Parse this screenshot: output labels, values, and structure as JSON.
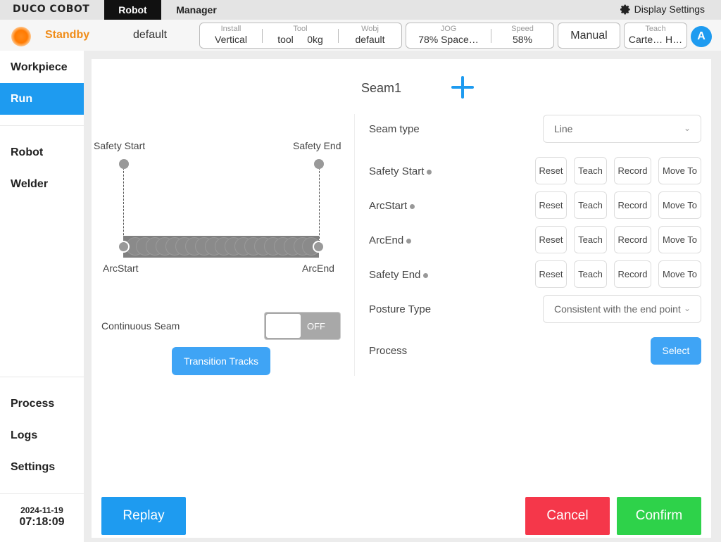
{
  "topbar": {
    "logo": "DUCO COBOT",
    "tabs": [
      "Robot",
      "Manager"
    ],
    "display_settings": "Display Settings"
  },
  "status": {
    "state": "Standby",
    "project": "default",
    "install_label": "Install",
    "install_value": "Vertical",
    "tool_label": "Tool",
    "tool_value": "tool",
    "tool_weight": "0kg",
    "wobj_label": "Wobj",
    "wobj_value": "default",
    "jog_label": "JOG",
    "jog_value": "78%  Space…",
    "speed_label": "Speed",
    "speed_value": "58%",
    "mode": "Manual",
    "teach_label": "Teach",
    "teach_value": "Carte… H…",
    "user_initial": "A",
    "accent_color": "#1e9bf0",
    "status_color": "#f08c18"
  },
  "sidebar": {
    "items": [
      "Workpiece",
      "Run",
      "Robot",
      "Welder",
      "Process",
      "Logs",
      "Settings"
    ],
    "active": "Run",
    "date": "2024-11-19",
    "time": "07:18:09"
  },
  "seam": {
    "title": "Seam1",
    "diagram": {
      "safety_start": "Safety Start",
      "safety_end": "Safety End",
      "arc_start": "ArcStart",
      "arc_end": "ArcEnd"
    },
    "continuous_label": "Continuous Seam",
    "continuous_state": "OFF",
    "transition_button": "Transition Tracks",
    "fields": {
      "seam_type_label": "Seam type",
      "seam_type_value": "Line",
      "posture_label": "Posture Type",
      "posture_value": "Consistent with the end point",
      "process_label": "Process",
      "process_button": "Select"
    },
    "points": [
      {
        "label": "Safety Start"
      },
      {
        "label": "ArcStart"
      },
      {
        "label": "ArcEnd"
      },
      {
        "label": "Safety End"
      }
    ],
    "actions": {
      "reset": "Reset",
      "teach": "Teach",
      "record": "Record",
      "move_to": "Move To"
    }
  },
  "footer": {
    "replay": "Replay",
    "cancel": "Cancel",
    "confirm": "Confirm"
  }
}
